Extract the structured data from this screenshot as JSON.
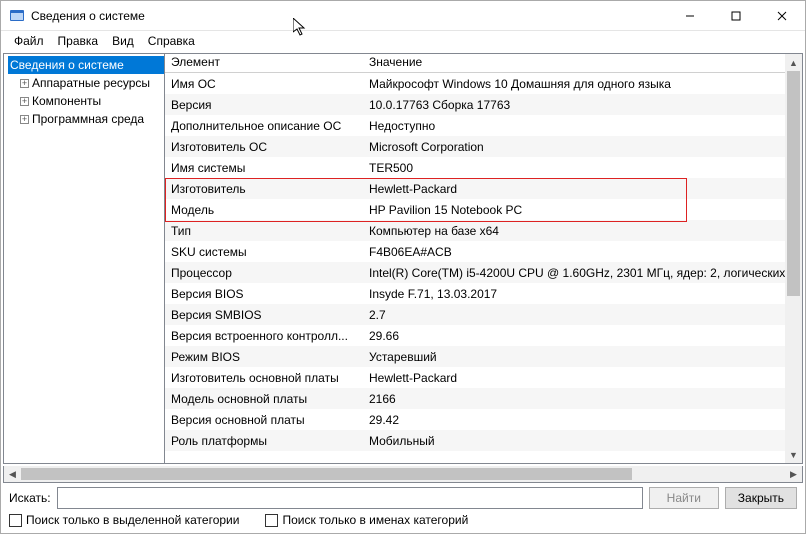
{
  "titlebar": {
    "title": "Сведения о системе"
  },
  "menu": [
    "Файл",
    "Правка",
    "Вид",
    "Справка"
  ],
  "tree": {
    "root": "Сведения о системе",
    "children": [
      {
        "label": "Аппаратные ресурсы",
        "expandable": true
      },
      {
        "label": "Компоненты",
        "expandable": true
      },
      {
        "label": "Программная среда",
        "expandable": true
      }
    ]
  },
  "details": {
    "headers": [
      "Элемент",
      "Значение"
    ],
    "rows": [
      {
        "k": "Имя ОС",
        "v": "Майкрософт Windows 10 Домашняя для одного языка"
      },
      {
        "k": "Версия",
        "v": "10.0.17763 Сборка 17763"
      },
      {
        "k": "Дополнительное описание ОС",
        "v": "Недоступно"
      },
      {
        "k": "Изготовитель ОС",
        "v": "Microsoft Corporation"
      },
      {
        "k": "Имя системы",
        "v": "TER500"
      },
      {
        "k": "Изготовитель",
        "v": "Hewlett-Packard"
      },
      {
        "k": "Модель",
        "v": "HP Pavilion 15 Notebook PC"
      },
      {
        "k": "Тип",
        "v": "Компьютер на базе x64"
      },
      {
        "k": "SKU системы",
        "v": "F4B06EA#ACB"
      },
      {
        "k": "Процессор",
        "v": "Intel(R) Core(TM) i5-4200U CPU @ 1.60GHz, 2301 МГц, ядер: 2, логических"
      },
      {
        "k": "Версия BIOS",
        "v": "Insyde F.71, 13.03.2017"
      },
      {
        "k": "Версия SMBIOS",
        "v": "2.7"
      },
      {
        "k": "Версия встроенного контролл...",
        "v": "29.66"
      },
      {
        "k": "Режим BIOS",
        "v": "Устаревший"
      },
      {
        "k": "Изготовитель основной платы",
        "v": "Hewlett-Packard"
      },
      {
        "k": "Модель основной платы",
        "v": "2166"
      },
      {
        "k": "Версия основной платы",
        "v": "29.42"
      },
      {
        "k": "Роль платформы",
        "v": "Мобильный"
      }
    ]
  },
  "search": {
    "label": "Искать:",
    "value": "",
    "find_btn": "Найти",
    "close_btn": "Закрыть",
    "opt_selected_category": "Поиск только в выделенной категории",
    "opt_category_names": "Поиск только в именах категорий"
  }
}
